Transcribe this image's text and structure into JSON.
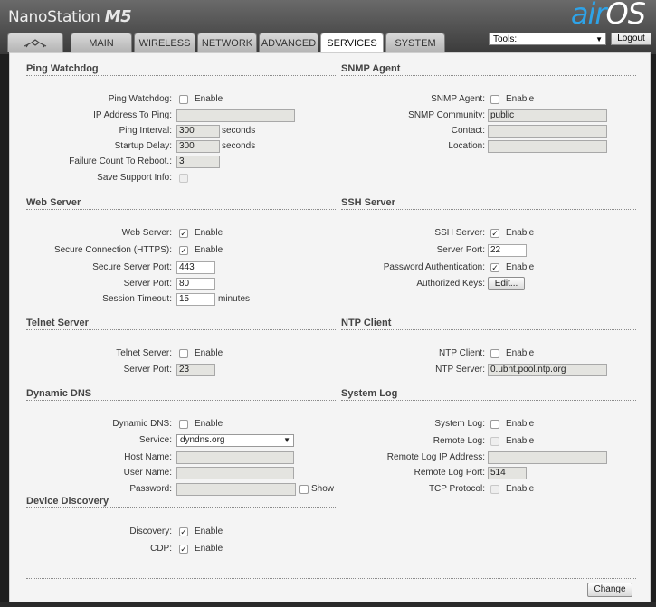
{
  "header": {
    "brand": "NanoStation",
    "model": "M5",
    "logo_air": "air",
    "logo_os": "OS"
  },
  "tabs": [
    "",
    "MAIN",
    "WIRELESS",
    "NETWORK",
    "ADVANCED",
    "SERVICES",
    "SYSTEM"
  ],
  "tools": {
    "label": "Tools:",
    "logout": "Logout"
  },
  "ping": {
    "title": "Ping Watchdog",
    "enable_label": "Ping Watchdog:",
    "enable_text": "Enable",
    "ip_label": "IP Address To Ping:",
    "ip_value": "",
    "interval_label": "Ping Interval:",
    "interval_value": "300",
    "interval_unit": "seconds",
    "delay_label": "Startup Delay:",
    "delay_value": "300",
    "delay_unit": "seconds",
    "failure_label": "Failure Count To Reboot.:",
    "failure_value": "3",
    "support_label": "Save Support Info:"
  },
  "snmp": {
    "title": "SNMP Agent",
    "agent_label": "SNMP Agent:",
    "enable_text": "Enable",
    "community_label": "SNMP Community:",
    "community_value": "public",
    "contact_label": "Contact:",
    "contact_value": "",
    "location_label": "Location:",
    "location_value": ""
  },
  "web": {
    "title": "Web Server",
    "server_label": "Web Server:",
    "enable_text": "Enable",
    "https_label": "Secure Connection (HTTPS):",
    "https_text": "Enable",
    "secure_port_label": "Secure Server Port:",
    "secure_port_value": "443",
    "port_label": "Server Port:",
    "port_value": "80",
    "timeout_label": "Session Timeout:",
    "timeout_value": "15",
    "timeout_unit": "minutes"
  },
  "ssh": {
    "title": "SSH Server",
    "server_label": "SSH Server:",
    "enable_text": "Enable",
    "port_label": "Server Port:",
    "port_value": "22",
    "pw_label": "Password Authentication:",
    "pw_text": "Enable",
    "keys_label": "Authorized Keys:",
    "keys_button": "Edit..."
  },
  "telnet": {
    "title": "Telnet Server",
    "server_label": "Telnet Server:",
    "enable_text": "Enable",
    "port_label": "Server Port:",
    "port_value": "23"
  },
  "ntp": {
    "title": "NTP Client",
    "client_label": "NTP Client:",
    "enable_text": "Enable",
    "server_label": "NTP Server:",
    "server_value": "0.ubnt.pool.ntp.org"
  },
  "ddns": {
    "title": "Dynamic DNS",
    "ddns_label": "Dynamic DNS:",
    "enable_text": "Enable",
    "service_label": "Service:",
    "service_value": "dyndns.org",
    "host_label": "Host Name:",
    "host_value": "",
    "user_label": "User Name:",
    "user_value": "",
    "password_label": "Password:",
    "password_value": "",
    "show_text": "Show"
  },
  "syslog": {
    "title": "System Log",
    "log_label": "System Log:",
    "log_text": "Enable",
    "remote_label": "Remote Log:",
    "remote_text": "Enable",
    "ip_label": "Remote Log IP Address:",
    "ip_value": "",
    "port_label": "Remote Log Port:",
    "port_value": "514",
    "tcp_label": "TCP Protocol:",
    "tcp_text": "Enable"
  },
  "discovery": {
    "title": "Device Discovery",
    "discovery_label": "Discovery:",
    "discovery_text": "Enable",
    "cdp_label": "CDP:",
    "cdp_text": "Enable"
  },
  "actions": {
    "change": "Change"
  },
  "colors": {
    "accent": "#2ea3e8",
    "panel": "#f4f4f4",
    "header": "#4a4a4a"
  }
}
